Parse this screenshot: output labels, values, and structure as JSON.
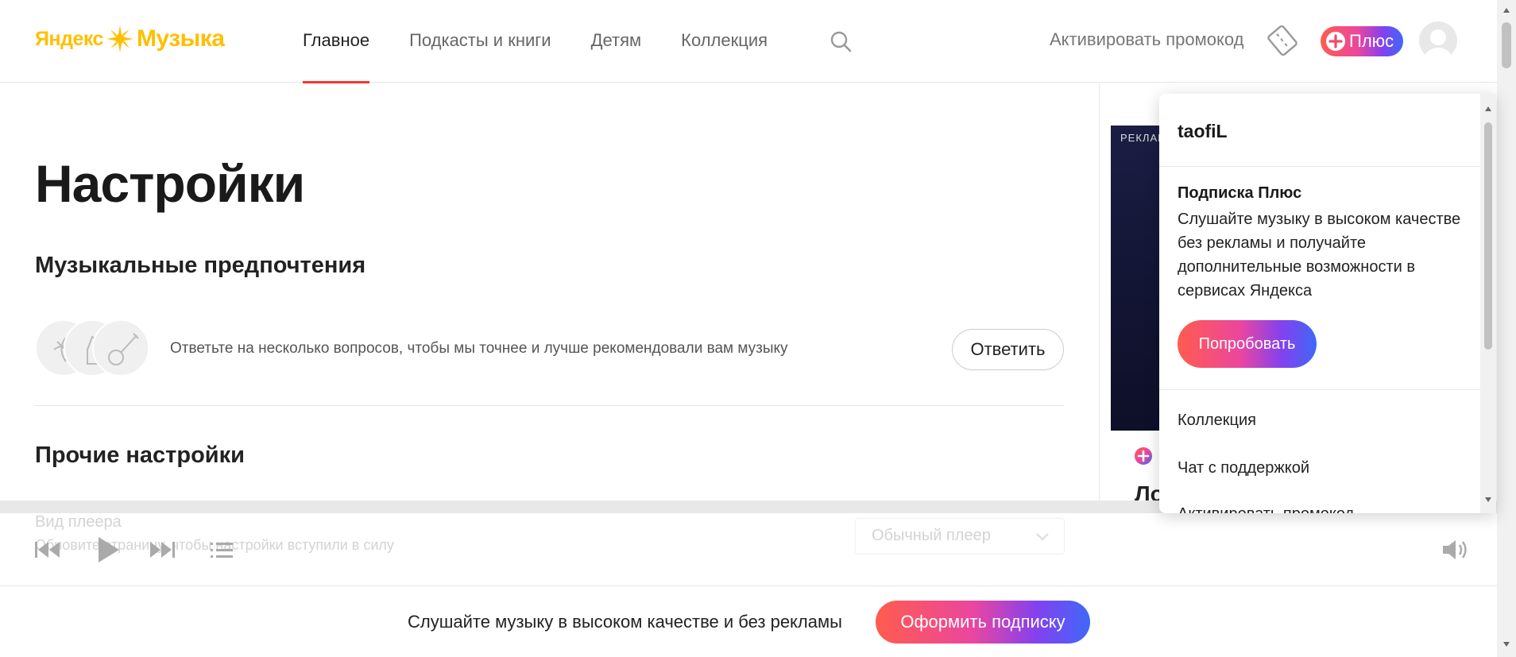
{
  "header": {
    "logo_yandex": "Яндекс",
    "logo_music": "Музыка",
    "nav": [
      {
        "label": "Главное",
        "active": true
      },
      {
        "label": "Подкасты и книги",
        "active": false
      },
      {
        "label": "Детям",
        "active": false
      },
      {
        "label": "Коллекция",
        "active": false
      }
    ],
    "promo_link": "Активировать промокод",
    "plus_label": "Плюс"
  },
  "main": {
    "title": "Настройки",
    "music_prefs_title": "Музыкальные предпочтения",
    "prefs_text": "Ответьте на несколько вопросов, чтобы мы точнее и лучше рекомендовали вам музыку",
    "answer_button": "Ответить",
    "other_title": "Прочие настройки",
    "player_view_label": "Вид плеера",
    "player_view_hint": "Обновите страницу, чтобы настройки вступили в силу",
    "player_view_value": "Обычный плеер"
  },
  "ad": {
    "label": "РЕКЛАМА",
    "title_fragment": "Ло"
  },
  "dropdown": {
    "username": "taofiL",
    "subscription_title": "Подписка Плюс",
    "subscription_text": "Слушайте музыку в высоком качестве без рекламы и получайте дополнительные возможности в сервисах Яндекса",
    "try_button": "Попробовать",
    "links": [
      "Коллекция",
      "Чат с поддержкой",
      "Активировать промокод"
    ]
  },
  "bottom_bar": {
    "text": "Слушайте музыку в высоком качестве и без рекламы",
    "subscribe_button": "Оформить подписку"
  },
  "colors": {
    "brand_yellow": "#ffbf00",
    "nav_active_underline": "#ff3333",
    "plus_gradient_start": "#ff5c4d",
    "plus_gradient_end": "#3f68f9"
  }
}
